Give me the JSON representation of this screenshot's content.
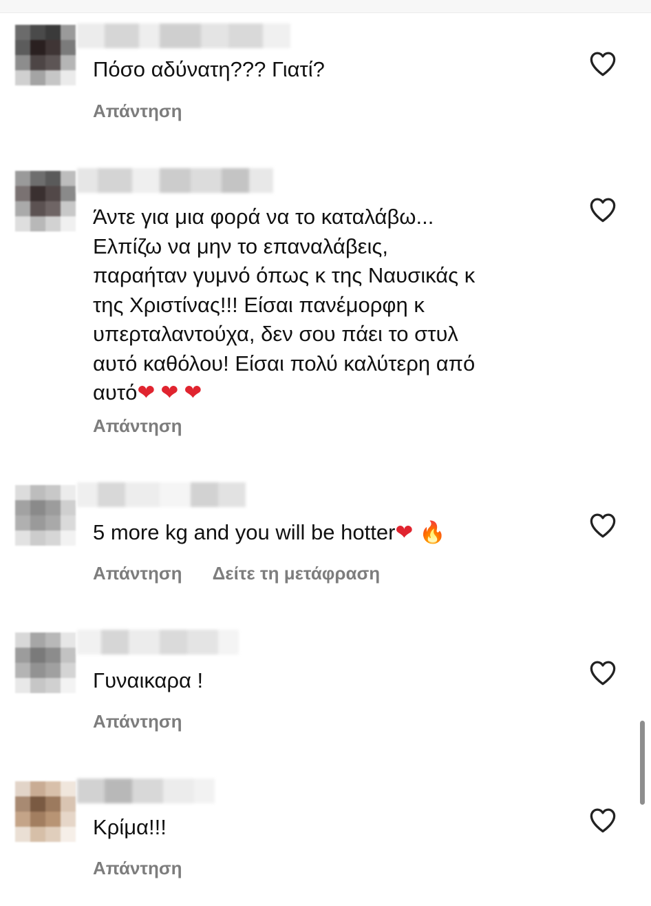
{
  "comments": [
    {
      "text": "Πόσο αδύνατη??? Γιατί?",
      "reply_label": "Απάντηση"
    },
    {
      "text": "Άντε για μια φορά να το καταλάβω...\nΕλπίζω να μην το επαναλάβεις,\nπαραήταν γυμνό όπως κ της Ναυσικάς κ\nτης Χριστίνας!!! Είσαι πανέμορφη κ\nυπερταλαντούχα, δεν σου πάει το στυλ\nαυτό καθόλου! Είσαι πολύ καλύτερη από\nαυτό",
      "emoji": "❤❤❤",
      "reply_label": "Απάντηση"
    },
    {
      "text": "5 more kg and you will be hotter",
      "emoji_heart": "❤",
      "emoji_fire": "🔥",
      "reply_label": "Απάντηση",
      "translate_label": "Δείτε τη μετάφραση"
    },
    {
      "text": "Γυναικαρα !",
      "reply_label": "Απάντηση"
    },
    {
      "text": "Κρίμα!!!",
      "reply_label": "Απάντηση"
    }
  ],
  "icons": {
    "like": "heart-outline-icon",
    "avatar": "blurred-avatar"
  },
  "colors": {
    "text": "#111111",
    "secondary": "#7d7d7d",
    "red_heart": "#e0242f",
    "fire": "#f08a1a"
  }
}
